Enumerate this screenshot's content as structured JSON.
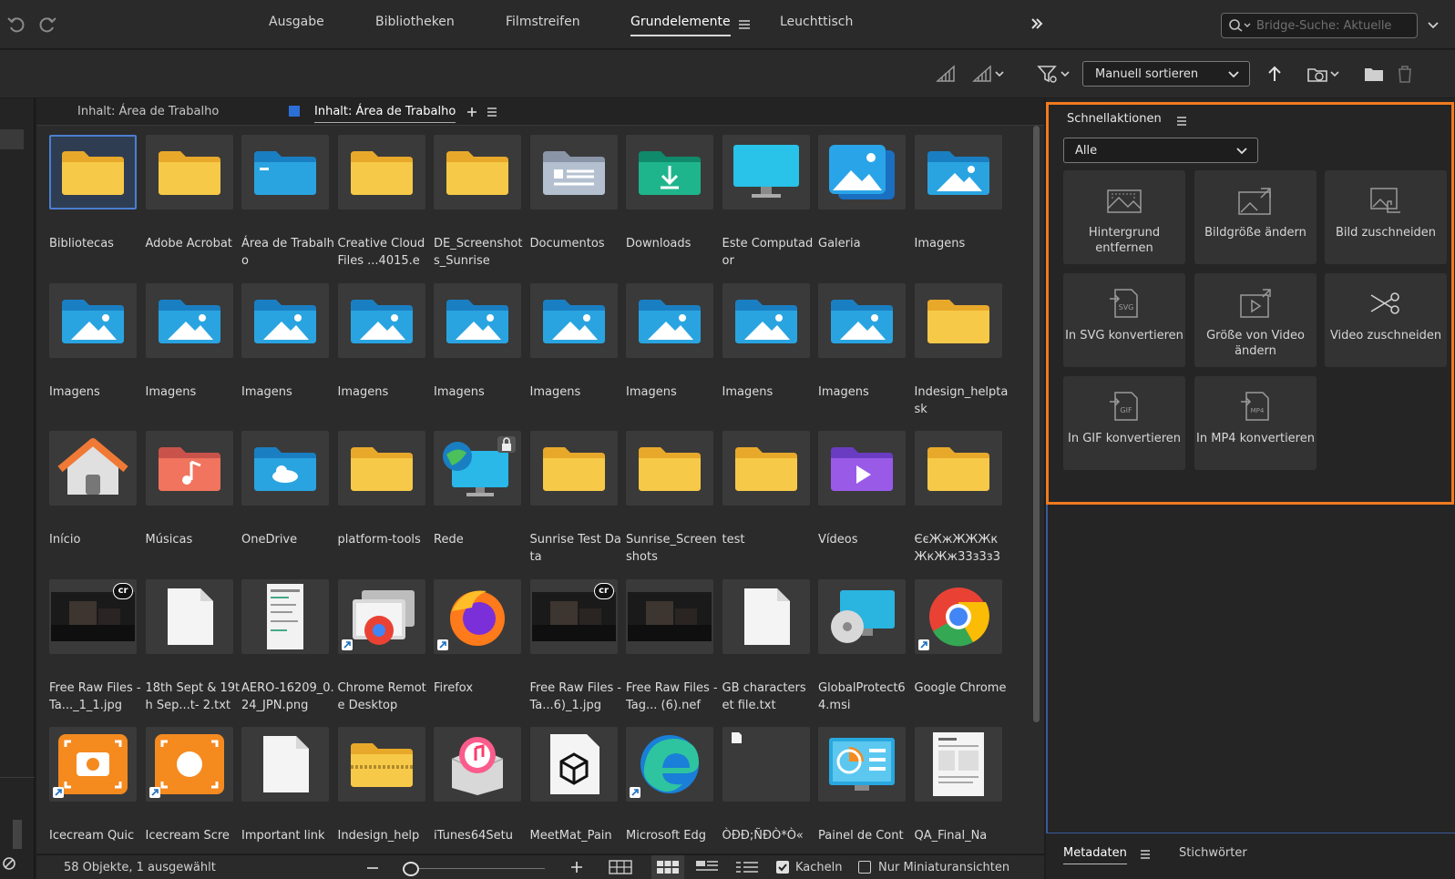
{
  "nav": {
    "tabs": [
      {
        "label": "Ausgabe"
      },
      {
        "label": "Bibliotheken"
      },
      {
        "label": "Filmstreifen"
      },
      {
        "label": "Grundelemente"
      },
      {
        "label": "Leuchttisch"
      }
    ],
    "active_tab": "Grundelemente",
    "search_placeholder": "Bridge-Suche: Aktuelle"
  },
  "toolbar": {
    "sort_label": "Manuell sortieren"
  },
  "content": {
    "tabs": [
      {
        "label": "Inhalt: Área de Trabalho"
      },
      {
        "label": "Inhalt: Área de Trabalho"
      }
    ],
    "items": [
      {
        "label": "Bibliotecas",
        "icon": "folder-icon",
        "selected": true
      },
      {
        "label": "Adobe Acrobat",
        "icon": "folder-icon"
      },
      {
        "label": "Área de Trabalho",
        "icon": "desktop-folder-icon"
      },
      {
        "label": "Creative Cloud Files ...4015.e",
        "icon": "folder-icon"
      },
      {
        "label": "DE_Screenshots_Sunrise",
        "icon": "folder-icon"
      },
      {
        "label": "Documentos",
        "icon": "documents-folder-icon"
      },
      {
        "label": "Downloads",
        "icon": "downloads-folder-icon"
      },
      {
        "label": "Este Computador",
        "icon": "monitor-icon"
      },
      {
        "label": "Galeria",
        "icon": "gallery-icon"
      },
      {
        "label": "Imagens",
        "icon": "pictures-folder-icon"
      },
      {
        "label": "Imagens",
        "icon": "pictures-folder-icon"
      },
      {
        "label": "Imagens",
        "icon": "pictures-folder-icon"
      },
      {
        "label": "Imagens",
        "icon": "pictures-folder-icon"
      },
      {
        "label": "Imagens",
        "icon": "pictures-folder-icon"
      },
      {
        "label": "Imagens",
        "icon": "pictures-folder-icon"
      },
      {
        "label": "Imagens",
        "icon": "pictures-folder-icon"
      },
      {
        "label": "Imagens",
        "icon": "pictures-folder-icon"
      },
      {
        "label": "Imagens",
        "icon": "pictures-folder-icon"
      },
      {
        "label": "Imagens",
        "icon": "pictures-folder-icon"
      },
      {
        "label": "Indesign_helptask",
        "icon": "folder-icon"
      },
      {
        "label": "Início",
        "icon": "home-icon"
      },
      {
        "label": "Músicas",
        "icon": "music-folder-icon"
      },
      {
        "label": "OneDrive",
        "icon": "onedrive-folder-icon"
      },
      {
        "label": "platform-tools",
        "icon": "folder-icon"
      },
      {
        "label": "Rede",
        "icon": "network-icon",
        "locked": true
      },
      {
        "label": "Sunrise Test Data",
        "icon": "folder-icon"
      },
      {
        "label": "Sunrise_Screenshots",
        "icon": "folder-icon"
      },
      {
        "label": "test",
        "icon": "folder-icon"
      },
      {
        "label": "Vídeos",
        "icon": "videos-folder-icon"
      },
      {
        "label": "ЄєЖжЖЖЖкЖкЖж33з3з3",
        "icon": "folder-icon"
      },
      {
        "label": "Free Raw Files - Ta..._1_1.jpg",
        "icon": "photo-thumb-icon",
        "badge": "cr"
      },
      {
        "label": "18th Sept & 19th Sep...t- 2.txt",
        "icon": "blank-file-icon"
      },
      {
        "label": "AERO-16209_0.24_JPN.png",
        "icon": "screenshot-thumb-icon"
      },
      {
        "label": "Chrome Remote Desktop",
        "icon": "chrome-remote-icon",
        "shortcut": true
      },
      {
        "label": "Firefox",
        "icon": "firefox-icon",
        "shortcut": true
      },
      {
        "label": "Free Raw Files - Ta...6)_1.jpg",
        "icon": "photo-thumb-icon",
        "badge": "cr"
      },
      {
        "label": "Free Raw Files - Tag... (6).nef",
        "icon": "photo-thumb-icon"
      },
      {
        "label": "GB characters et file.txt",
        "icon": "blank-file-icon"
      },
      {
        "label": "GlobalProtect64.msi",
        "icon": "installer-icon"
      },
      {
        "label": "Google Chrome",
        "icon": "chrome-icon",
        "shortcut": true
      },
      {
        "label": "Icecream Quic",
        "icon": "icecream-icon",
        "shortcut": true
      },
      {
        "label": "Icecream Scre",
        "icon": "icecream-rec-icon",
        "shortcut": true
      },
      {
        "label": "Important link",
        "icon": "blank-file-icon"
      },
      {
        "label": "Indesign_help",
        "icon": "zip-folder-icon"
      },
      {
        "label": "iTunes64Setu",
        "icon": "itunes-icon"
      },
      {
        "label": "MeetMat_Pain",
        "icon": "3d-file-icon"
      },
      {
        "label": "Microsoft Edg",
        "icon": "edge-icon",
        "shortcut": true
      },
      {
        "label": "ÒÐĐ;ÑÐÒ*Ò«",
        "icon": "small-file-icon"
      },
      {
        "label": "Painel de Cont",
        "icon": "control-panel-icon"
      },
      {
        "label": "QA_Final_Na",
        "icon": "document-thumb-icon"
      }
    ]
  },
  "status": {
    "count_text": "58 Objekte, 1 ausgewählt",
    "tiles_label": "Kacheln",
    "thumbs_only_label": "Nur Miniaturansichten"
  },
  "quick_actions": {
    "title": "Schnellaktionen",
    "filter_value": "Alle",
    "actions": [
      {
        "label": "Hintergrund entfernen",
        "icon": "remove-background-icon"
      },
      {
        "label": "Bildgröße ändern",
        "icon": "resize-image-icon"
      },
      {
        "label": "Bild zuschneiden",
        "icon": "crop-image-icon"
      },
      {
        "label": "In SVG konvertieren",
        "icon": "svg-convert-icon"
      },
      {
        "label": "Größe von Video ändern",
        "icon": "resize-video-icon"
      },
      {
        "label": "Video zuschneiden",
        "icon": "trim-video-icon"
      },
      {
        "label": "In GIF konvertieren",
        "icon": "gif-convert-icon"
      },
      {
        "label": "In MP4 konvertieren",
        "icon": "mp4-convert-icon"
      }
    ]
  },
  "bottom_tabs": {
    "metadata": "Metadaten",
    "keywords": "Stichwörter"
  },
  "colors": {
    "accent_orange": "#f07a1f",
    "folder_yellow": "#f7c948",
    "selection_blue": "#4a7fd0"
  }
}
